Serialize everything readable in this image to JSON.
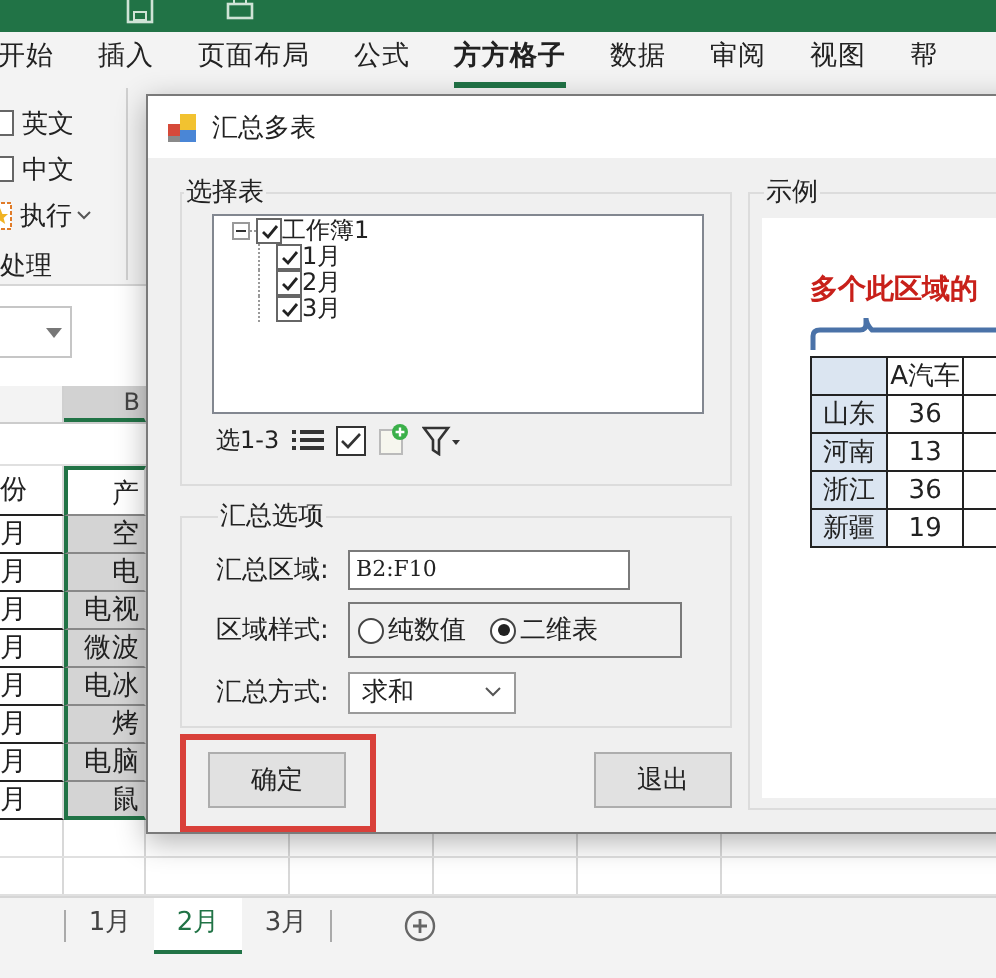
{
  "ribbon_tabs": [
    {
      "label": "开始",
      "selected": false
    },
    {
      "label": "插入",
      "selected": false
    },
    {
      "label": "页面布局",
      "selected": false
    },
    {
      "label": "公式",
      "selected": false
    },
    {
      "label": "方方格子",
      "selected": true
    },
    {
      "label": "数据",
      "selected": false
    },
    {
      "label": "审阅",
      "selected": false
    },
    {
      "label": "视图",
      "selected": false
    },
    {
      "label": "帮",
      "selected": false
    }
  ],
  "ribbon_group": {
    "label": "处理",
    "items": [
      {
        "kind": "checkbox",
        "label": "英文",
        "checked": false
      },
      {
        "kind": "checkbox",
        "label": "中文",
        "checked": false
      },
      {
        "kind": "dropdown",
        "label": "执行"
      }
    ]
  },
  "sheet": {
    "column_header": "B",
    "rows": [
      [
        "份",
        "产"
      ],
      [
        "月",
        "空"
      ],
      [
        "月",
        "电"
      ],
      [
        "月",
        "电视"
      ],
      [
        "月",
        "微波"
      ],
      [
        "月",
        "电冰"
      ],
      [
        "月",
        "烤"
      ],
      [
        "月",
        "电脑"
      ],
      [
        "月",
        "鼠"
      ]
    ]
  },
  "sheet_tabs": [
    {
      "label": "1月",
      "selected": false
    },
    {
      "label": "2月",
      "selected": true
    },
    {
      "label": "3月",
      "selected": false
    }
  ],
  "dialog": {
    "title": "汇总多表",
    "select_group": {
      "label": "选择表",
      "tree": [
        {
          "label": "工作簿1",
          "checked": true,
          "expanded": true,
          "children": [
            {
              "label": "1月",
              "checked": true
            },
            {
              "label": "2月",
              "checked": true
            },
            {
              "label": "3月",
              "checked": true
            }
          ]
        }
      ],
      "range_label": "选1-3"
    },
    "options_group": {
      "label": "汇总选项",
      "area_label": "汇总区域:",
      "area_value": "B2:F10",
      "style_label": "区域样式:",
      "styles": [
        {
          "label": "纯数值",
          "selected": false
        },
        {
          "label": "二维表",
          "selected": true
        }
      ],
      "method_label": "汇总方式:",
      "method_value": "求和"
    },
    "buttons": [
      {
        "label": "确定",
        "highlighted": true
      },
      {
        "label": "退出",
        "highlighted": false
      }
    ],
    "example_group": {
      "label": "示例",
      "caption": "多个此区域的",
      "table": {
        "columns": [
          "",
          "A汽车"
        ],
        "rows": [
          [
            "山东",
            "36"
          ],
          [
            "河南",
            "13"
          ],
          [
            "浙江",
            "36"
          ],
          [
            "新疆",
            "19"
          ]
        ]
      }
    }
  }
}
